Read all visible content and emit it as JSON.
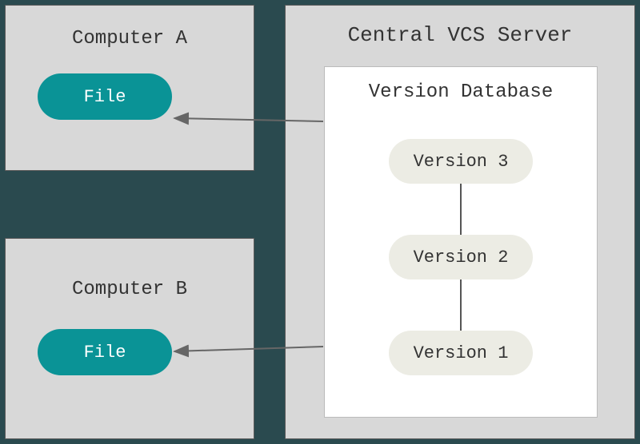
{
  "computerA": {
    "title": "Computer A",
    "file": "File"
  },
  "computerB": {
    "title": "Computer B",
    "file": "File"
  },
  "server": {
    "title": "Central VCS Server",
    "database": {
      "title": "Version Database",
      "versions": {
        "v3": "Version 3",
        "v2": "Version 2",
        "v1": "Version 1"
      }
    }
  }
}
